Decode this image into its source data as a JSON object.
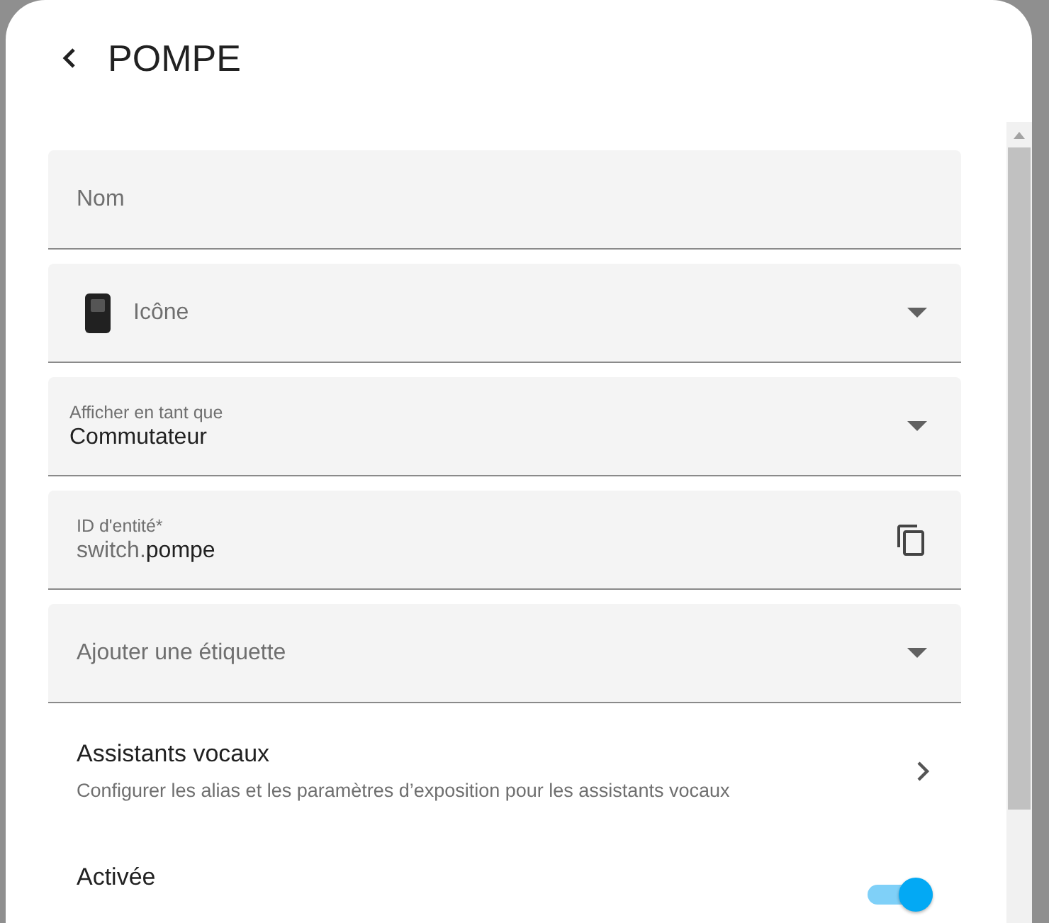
{
  "dialog": {
    "title": "POMPE"
  },
  "fields": [
    {
      "kind": "text",
      "placeholder": "Nom"
    },
    {
      "kind": "icon-select",
      "placeholder": "Icône"
    },
    {
      "kind": "select",
      "label": "Afficher en tant que",
      "value": "Commutateur"
    },
    {
      "kind": "entity-id",
      "label": "ID d'entité*",
      "prefix": "switch.",
      "value": "pompe"
    },
    {
      "kind": "select",
      "placeholder": "Ajouter une étiquette"
    }
  ],
  "voice_assistants": {
    "title": "Assistants vocaux",
    "subtitle": "Configurer les alias et les paramètres d’exposition pour les assistants vocaux"
  },
  "enabled": {
    "label": "Activée",
    "on": true
  }
}
